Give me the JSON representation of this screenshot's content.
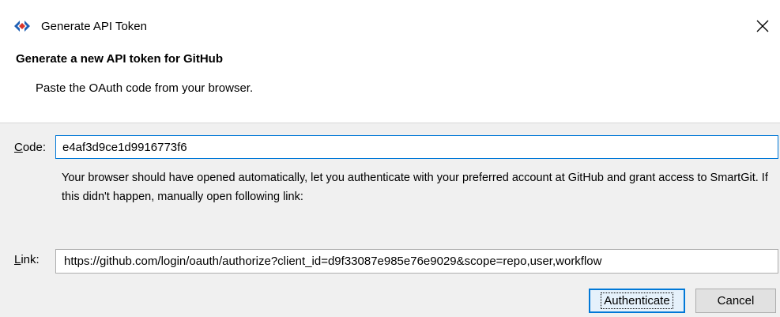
{
  "window": {
    "title": "Generate API Token",
    "icons": {
      "app": "smartgit-diamond-icon",
      "close": "close-icon"
    }
  },
  "dialog": {
    "heading": "Generate a new API token for GitHub",
    "subtitle": "Paste the OAuth code from your browser."
  },
  "code": {
    "label_prefix": "C",
    "label_rest": "ode:",
    "value": "e4af3d9ce1d9916773f6"
  },
  "help_text": "Your browser should have opened automatically, let you authenticate with your preferred account at GitHub and grant access to SmartGit. If this didn't happen, manually open following link:",
  "link": {
    "label_prefix": "L",
    "label_rest": "ink:",
    "value": "https://github.com/login/oauth/authorize?client_id=d9f33087e985e76e9029&scope=repo,user,workflow"
  },
  "buttons": {
    "authenticate": "Authenticate",
    "cancel": "Cancel"
  },
  "colors": {
    "accent": "#0078d7",
    "app_icon_blue": "#1e5fb4",
    "app_icon_red": "#d9362b"
  }
}
